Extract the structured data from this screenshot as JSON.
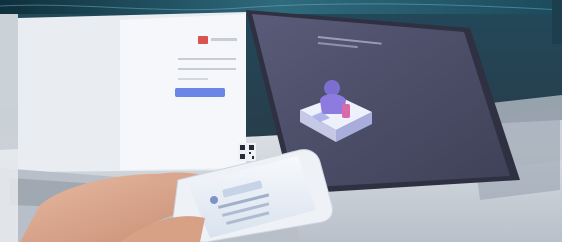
{
  "photo": {
    "subject": "laptop-and-phone-photo",
    "colors": {
      "banner": "#1f4f63",
      "laptop_screen": "#4d4f6a",
      "laptop_body": "#cfd6de",
      "login_panel": "#f3f5f8",
      "accent_button": "#6c86e8",
      "brand_red": "#d9534f",
      "isometric_card": "#eef0fb"
    }
  }
}
